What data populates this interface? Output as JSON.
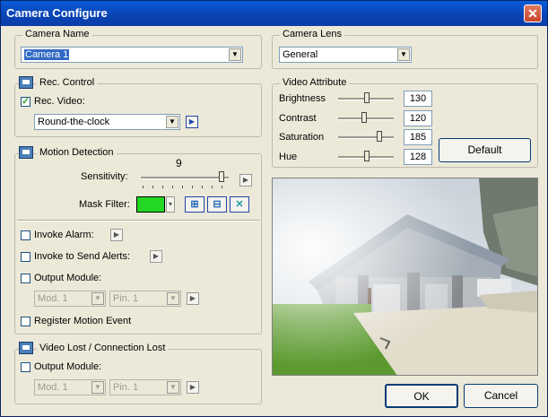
{
  "window": {
    "title": "Camera Configure",
    "close_symbol": "✕"
  },
  "camera_name": {
    "label": "Camera Name",
    "value": "Camera 1"
  },
  "camera_lens": {
    "label": "Camera Lens",
    "value": "General"
  },
  "rec_control": {
    "label": "Rec. Control",
    "rec_video_label": "Rec. Video:",
    "rec_video_checked": true,
    "schedule_value": "Round-the-clock"
  },
  "motion_detection": {
    "label": "Motion Detection",
    "sensitivity_label": "Sensitivity:",
    "sensitivity_value": "9",
    "mask_filter_label": "Mask Filter:",
    "mask_color": "#22d822",
    "mask_add_icon": "grid-add-icon",
    "mask_remove_icon": "grid-remove-icon",
    "mask_clear_icon": "clear-x-icon",
    "invoke_alarm_label": "Invoke Alarm:",
    "invoke_alerts_label": "Invoke to Send Alerts:",
    "output_module_label": "Output Module:",
    "mod_value": "Mod. 1",
    "pin_value": "Pin. 1",
    "register_event_label": "Register Motion Event"
  },
  "video_lost": {
    "label": "Video Lost / Connection Lost",
    "output_module_label": "Output Module:",
    "mod_value": "Mod. 1",
    "pin_value": "Pin. 1"
  },
  "video_attribute": {
    "label": "Video Attribute",
    "brightness": {
      "label": "Brightness",
      "value": "130"
    },
    "contrast": {
      "label": "Contrast",
      "value": "120"
    },
    "saturation": {
      "label": "Saturation",
      "value": "185"
    },
    "hue": {
      "label": "Hue",
      "value": "128"
    },
    "default_button": "Default"
  },
  "buttons": {
    "ok": "OK",
    "cancel": "Cancel"
  }
}
